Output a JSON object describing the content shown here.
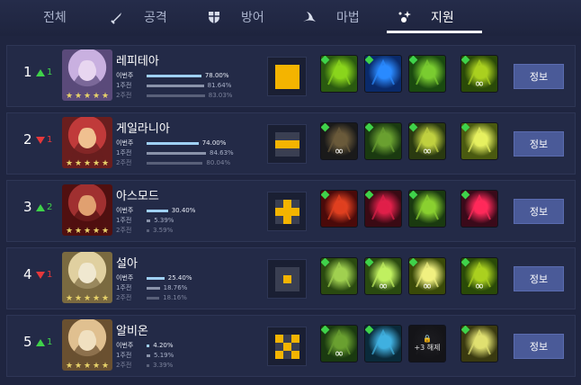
{
  "tabs": [
    {
      "label": "전체",
      "icon": "none-icon",
      "active": false
    },
    {
      "label": "공격",
      "icon": "sword-icon",
      "active": false
    },
    {
      "label": "방어",
      "icon": "shield-icon",
      "active": false
    },
    {
      "label": "마법",
      "icon": "wizard-hat-icon",
      "active": false
    },
    {
      "label": "지원",
      "icon": "sparkle-support-icon",
      "active": true
    }
  ],
  "stat_labels": {
    "this_week": "이번주",
    "one_week": "1주전",
    "two_weeks": "2주전"
  },
  "info_label": "정보",
  "colors": {
    "up": "#3fd24a",
    "down": "#e6383b",
    "bar_this": "#9fd0f5",
    "bar_old": "#8a93aa",
    "pattern_on": "#f4b400",
    "pattern_off": "#3a3f52"
  },
  "rows": [
    {
      "rank": "1",
      "dir": "up",
      "delta": "1",
      "name": "레피테아",
      "this": "78.00%",
      "w1": "81.64%",
      "w2": "83.03%",
      "this_v": 78.0,
      "w1_v": 81.64,
      "w2_v": 83.03,
      "pattern": [
        1,
        1,
        1,
        1,
        1,
        1,
        1,
        1,
        1
      ],
      "portrait": [
        "#c9b0e0",
        "#5a4a7a",
        "#e8d6f0"
      ],
      "skills": [
        {
          "name": "green-bolt-skill-icon",
          "c": [
            "#2a5a10",
            "#8ad51c"
          ],
          "inf": false,
          "gem": true
        },
        {
          "name": "blue-beast-skill-icon",
          "c": [
            "#0a2a6a",
            "#2a8aff"
          ],
          "inf": false,
          "gem": true
        },
        {
          "name": "green-hex-skill-icon",
          "c": [
            "#1a4a10",
            "#7acc30"
          ],
          "inf": false,
          "gem": true
        },
        {
          "name": "green-figure-skill-icon",
          "c": [
            "#2a4a08",
            "#aad020"
          ],
          "inf": true,
          "gem": true
        }
      ]
    },
    {
      "rank": "2",
      "dir": "down",
      "delta": "1",
      "name": "게일라니아",
      "this": "74.00%",
      "w1": "84.63%",
      "w2": "80.04%",
      "this_v": 74.0,
      "w1_v": 84.63,
      "w2_v": 80.04,
      "pattern": [
        0,
        0,
        0,
        1,
        1,
        1,
        0,
        0,
        0
      ],
      "portrait": [
        "#c03a3a",
        "#6a1e1e",
        "#f0c090"
      ],
      "skills": [
        {
          "name": "shadow-rogue-skill-icon",
          "c": [
            "#1a1a1a",
            "#6a5a3a"
          ],
          "inf": true,
          "gem": true
        },
        {
          "name": "green-warrior-skill-icon",
          "c": [
            "#1a3a10",
            "#6aa030"
          ],
          "inf": false,
          "gem": true
        },
        {
          "name": "green-axe-skill-icon",
          "c": [
            "#2a3a10",
            "#c0d040"
          ],
          "inf": true,
          "gem": true
        },
        {
          "name": "yellow-green-skill-icon",
          "c": [
            "#4a5a10",
            "#e6f060"
          ],
          "inf": false,
          "gem": true
        }
      ]
    },
    {
      "rank": "3",
      "dir": "up",
      "delta": "2",
      "name": "아스모드",
      "this": "30.40%",
      "w1": "5.39%",
      "w2": "3.59%",
      "this_v": 30.4,
      "w1_v": 5.39,
      "w2_v": 3.59,
      "pattern": [
        0,
        1,
        0,
        1,
        1,
        1,
        0,
        1,
        0
      ],
      "portrait": [
        "#a03030",
        "#501010",
        "#e0a070"
      ],
      "skills": [
        {
          "name": "red-orb-skill-icon",
          "c": [
            "#4a0a0a",
            "#e04020"
          ],
          "inf": false,
          "gem": true
        },
        {
          "name": "red-mist-skill-icon",
          "c": [
            "#3a0a14",
            "#e0204a"
          ],
          "inf": false,
          "gem": true
        },
        {
          "name": "green-spear-skill-icon",
          "c": [
            "#1a3a10",
            "#8ad030"
          ],
          "inf": false,
          "gem": true
        },
        {
          "name": "crimson-slash-skill-icon",
          "c": [
            "#3a0a1a",
            "#ff2a5a"
          ],
          "inf": false,
          "gem": true
        }
      ]
    },
    {
      "rank": "4",
      "dir": "down",
      "delta": "1",
      "name": "설아",
      "this": "25.40%",
      "w1": "18.76%",
      "w2": "18.16%",
      "this_v": 25.4,
      "w1_v": 18.76,
      "w2_v": 18.16,
      "pattern": [
        0,
        0,
        0,
        0,
        1,
        0,
        0,
        0,
        0
      ],
      "portrait": [
        "#e0d0a0",
        "#7a6a40",
        "#f0e8d0"
      ],
      "skills": [
        {
          "name": "clover-skill-icon",
          "c": [
            "#2a4a10",
            "#a0d050"
          ],
          "inf": false,
          "gem": true
        },
        {
          "name": "green-burst-skill-icon",
          "c": [
            "#2a4a10",
            "#c0f060"
          ],
          "inf": true,
          "gem": true
        },
        {
          "name": "yellow-rays-skill-icon",
          "c": [
            "#3a4a08",
            "#f0f080"
          ],
          "inf": true,
          "gem": true
        },
        {
          "name": "green-figure-skill-icon",
          "c": [
            "#2a4a08",
            "#aad020"
          ],
          "inf": true,
          "gem": true
        }
      ]
    },
    {
      "rank": "5",
      "dir": "up",
      "delta": "1",
      "name": "알비온",
      "this": "4.20%",
      "w1": "5.19%",
      "w2": "3.39%",
      "this_v": 4.2,
      "w1_v": 5.19,
      "w2_v": 3.39,
      "pattern": [
        1,
        0,
        1,
        0,
        1,
        0,
        1,
        0,
        1
      ],
      "portrait": [
        "#e0c090",
        "#6a5030",
        "#f0e0c0"
      ],
      "skills": [
        {
          "name": "green-warrior-skill-icon",
          "c": [
            "#1a3a10",
            "#6aa030"
          ],
          "inf": true,
          "gem": true
        },
        {
          "name": "ice-thorn-skill-icon",
          "c": [
            "#0a2a3a",
            "#40b0e0"
          ],
          "inf": false,
          "gem": true
        },
        {
          "name": "locked-skill-icon",
          "c": [
            "#1a1a1a",
            "#3a3a3a"
          ],
          "inf": false,
          "gem": false,
          "locked": true,
          "lock_text": "+3 해제"
        },
        {
          "name": "gold-star-skill-icon",
          "c": [
            "#3a3a10",
            "#e0e070"
          ],
          "inf": false,
          "gem": true
        }
      ]
    }
  ]
}
